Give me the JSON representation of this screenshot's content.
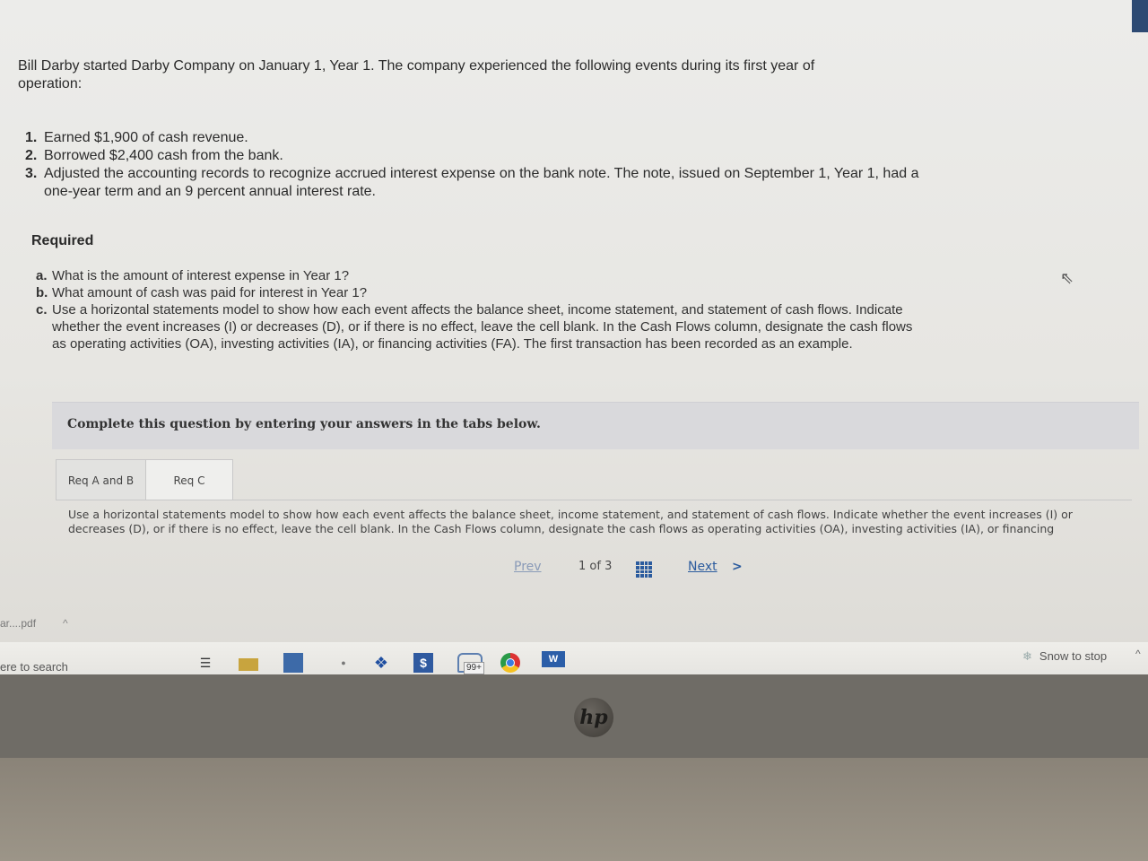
{
  "intro": "Bill Darby started Darby Company on January 1, Year 1. The company experienced the following events during its first year of operation:",
  "events": [
    {
      "num": "1.",
      "text": "Earned $1,900 of cash revenue."
    },
    {
      "num": "2.",
      "text": "Borrowed $2,400 cash from the bank."
    },
    {
      "num": "3.",
      "text": "Adjusted the accounting records to recognize accrued interest expense on the bank note. The note, issued on September 1, Year 1, had a one-year term and an 9 percent annual interest rate."
    }
  ],
  "required_heading": "Required",
  "questions": [
    {
      "letter": "a.",
      "text": "What is the amount of interest expense in Year 1?"
    },
    {
      "letter": "b.",
      "text": "What amount of cash was paid for interest in Year 1?"
    },
    {
      "letter": "c.",
      "text": "Use a horizontal statements model to show how each event affects the balance sheet, income statement, and statement of cash flows. Indicate whether the event increases (I) or decreases (D), or if there is no effect, leave the cell blank. In the Cash Flows column, designate the cash flows as operating activities (OA), investing activities (IA), or financing activities (FA). The first transaction has been recorded as an example."
    }
  ],
  "complete_bar": "Complete this question by entering your answers in the tabs below.",
  "tabs": [
    {
      "label": "Req A and B",
      "active": false
    },
    {
      "label": "Req C",
      "active": true
    }
  ],
  "tab_description": "Use a horizontal statements model to show how each event affects the balance sheet, income statement, and statement of cash flows. Indicate whether the event increases (I) or decreases (D), or if there is no effect, leave the cell blank. In the Cash Flows column, designate the cash flows as operating activities (OA), investing activities (IA), or financing",
  "pager": {
    "prev": "Prev",
    "page": "1",
    "of": "of",
    "total": "3",
    "next": "Next",
    "next_icon": "chevron-right-icon",
    "grid_icon": "grid-icon"
  },
  "download_bar": {
    "filename": "ar....pdf",
    "caret": "^"
  },
  "taskbar": {
    "search_text": "ere to search",
    "mail_badge": "99+",
    "word_label": "W",
    "dollar_label": "$",
    "snow_text": "Snow to stop",
    "tray_caret": "^",
    "icons": [
      "task-view-icon",
      "file-explorer-icon",
      "store-icon",
      "dropbox-icon",
      "dollar-app-icon",
      "mail-icon",
      "chrome-icon",
      "word-icon",
      "snow-weather-icon"
    ]
  },
  "bezel_logo": "hp",
  "colors": {
    "link": "#2c5c9e",
    "corner_tab": "#2d4a73",
    "complete_bar": "#d9d9dc"
  }
}
